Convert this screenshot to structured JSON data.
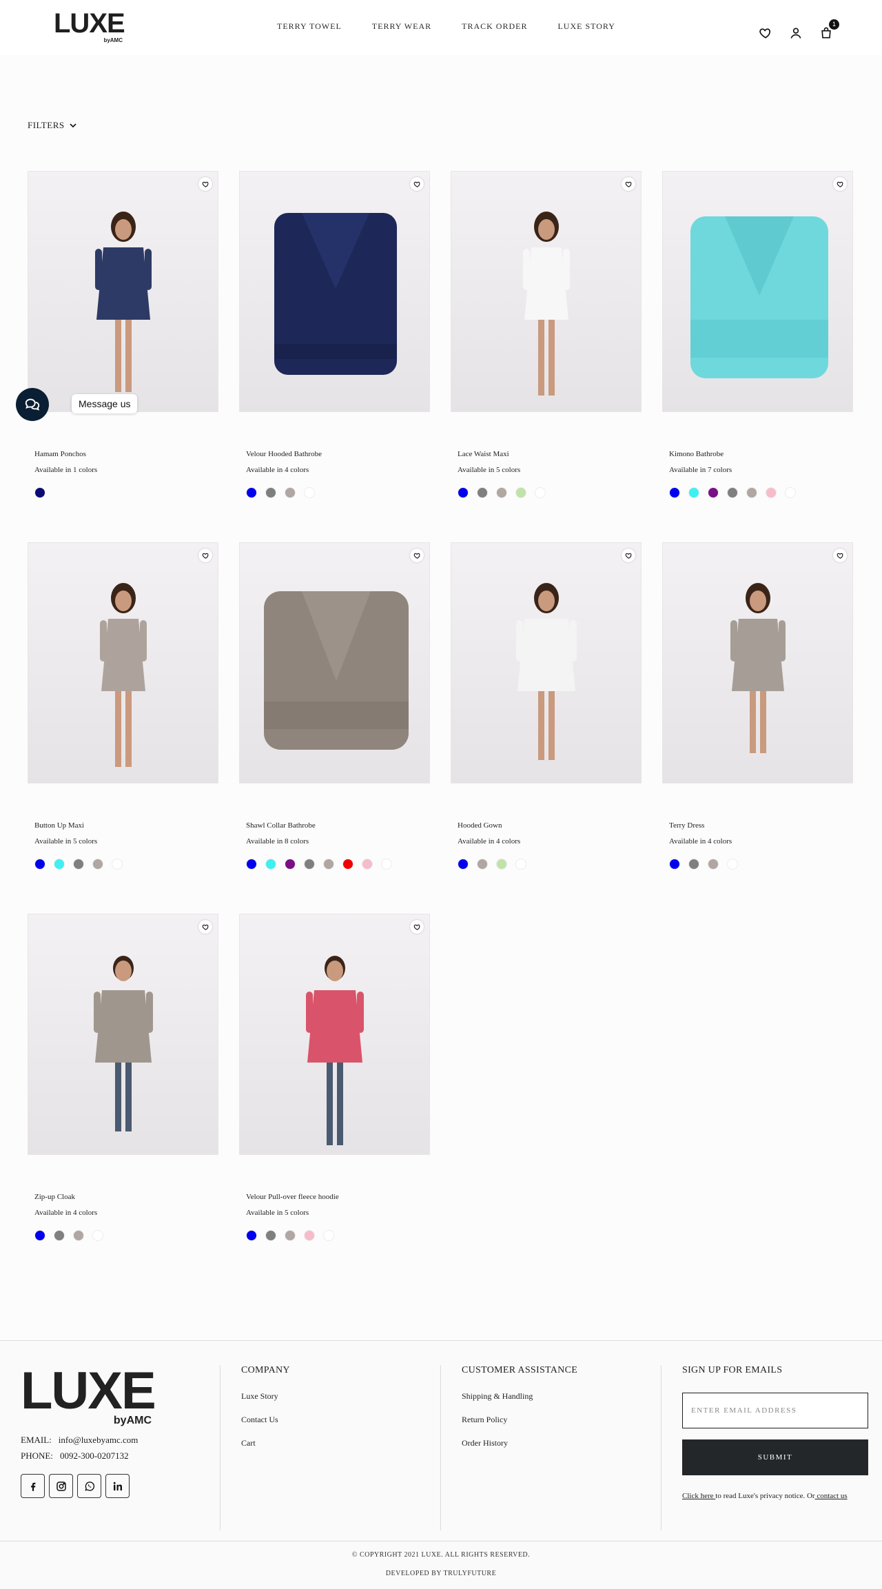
{
  "header": {
    "logo_text": "LUXE",
    "logo_sub": "byAMC",
    "nav": [
      "TERRY TOWEL",
      "TERRY WEAR",
      "TRACK ORDER",
      "LUXE STORY"
    ],
    "cart_count": "1"
  },
  "filters": {
    "label": "FILTERS"
  },
  "chat": {
    "label": "Message us"
  },
  "products": [
    {
      "name": "Hamam Ponchos",
      "availability": "Available in 1 colors",
      "colors": [
        "#0b0b73"
      ]
    },
    {
      "name": "Velour Hooded Bathrobe",
      "availability": "Available in 4 colors",
      "colors": [
        "#0000ee",
        "#7f7f7f",
        "#b0a6a2",
        "#ffffff"
      ]
    },
    {
      "name": "Lace Waist Maxi",
      "availability": "Available in 5 colors",
      "colors": [
        "#0000ee",
        "#7f7f7f",
        "#b0a6a2",
        "#bfe3a8",
        "#ffffff"
      ]
    },
    {
      "name": "Kimono Bathrobe",
      "availability": "Available in 7 colors",
      "colors": [
        "#0000ee",
        "#3ff0f0",
        "#7a0f88",
        "#7f7f7f",
        "#b0a6a2",
        "#f7bcca",
        "#ffffff"
      ]
    },
    {
      "name": "Button Up Maxi",
      "availability": "Available in 5 colors",
      "colors": [
        "#0000ee",
        "#3ff0f0",
        "#7f7f7f",
        "#b0a6a2",
        "#ffffff"
      ]
    },
    {
      "name": "Shawl Collar Bathrobe",
      "availability": "Available in 8 colors",
      "colors": [
        "#0000ee",
        "#3ff0f0",
        "#7a0f88",
        "#7f7f7f",
        "#b0a6a2",
        "#f20000",
        "#f7bcca",
        "#ffffff"
      ]
    },
    {
      "name": "Hooded Gown",
      "availability": "Available in 4 colors",
      "colors": [
        "#0000ee",
        "#b0a6a2",
        "#bfe3a8",
        "#ffffff"
      ]
    },
    {
      "name": "Terry Dress",
      "availability": "Available in 4 colors",
      "colors": [
        "#0000ee",
        "#7f7f7f",
        "#b0a6a2",
        "#ffffff"
      ]
    },
    {
      "name": "Zip-up Cloak",
      "availability": "Available in 4 colors",
      "colors": [
        "#0000ee",
        "#7f7f7f",
        "#b0a6a2",
        "#ffffff"
      ]
    },
    {
      "name": "Velour Pull-over fleece hoodie",
      "availability": "Available in 5 colors",
      "colors": [
        "#0000ee",
        "#7f7f7f",
        "#b0a6a2",
        "#f7bcca",
        "#ffffff"
      ]
    }
  ],
  "footer": {
    "logo_text": "LUXE",
    "logo_sub": "byAMC",
    "email_label": "EMAIL:",
    "email_value": "info@luxebyamc.com",
    "phone_label": "PHONE:",
    "phone_value": "0092-300-0207132",
    "company_heading": "COMPANY",
    "company_links": [
      "Luxe Story",
      "Contact Us",
      "Cart"
    ],
    "assistance_heading": "CUSTOMER ASSISTANCE",
    "assistance_links": [
      "Shipping & Handling",
      "Return Policy",
      "Order History"
    ],
    "signup_heading": "SIGN UP FOR EMAILS",
    "email_placeholder": "ENTER EMAIL ADDRESS",
    "submit_label": "SUBMIT",
    "privacy_link": "Click here ",
    "privacy_text": "to read Luxe's privacy notice. Or",
    "contact_link": " contact us",
    "copyright": "© COPYRIGHT 2021 LUXE. ALL RIGHTS RESERVED.",
    "developed_by": "DEVELOPED BY TRULYFUTURE"
  }
}
